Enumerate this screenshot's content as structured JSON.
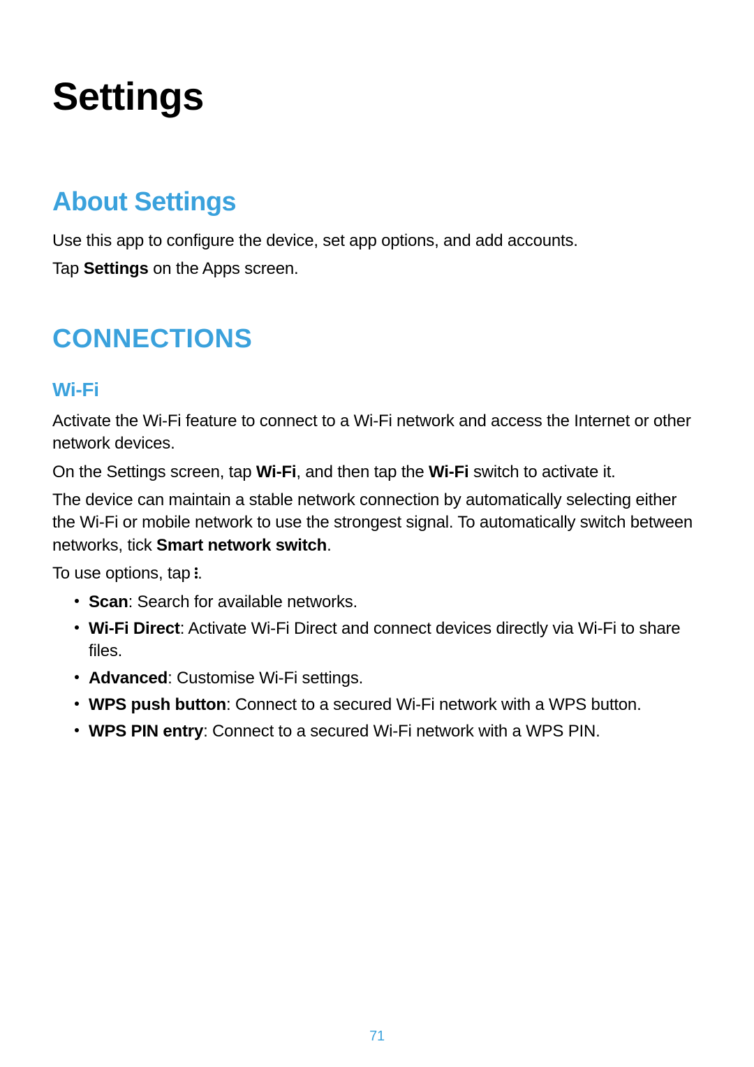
{
  "page_number": "71",
  "chapter_title": "Settings",
  "section_about": {
    "heading": "About Settings",
    "para1": "Use this app to configure the device, set app options, and add accounts.",
    "para2_prefix": "Tap ",
    "para2_bold": "Settings",
    "para2_suffix": " on the Apps screen."
  },
  "section_conn": {
    "heading": "CONNECTIONS",
    "wifi": {
      "heading": "Wi-Fi",
      "para1": "Activate the Wi-Fi feature to connect to a Wi-Fi network and access the Internet or other network devices.",
      "para2": {
        "a": "On the Settings screen, tap ",
        "b1": "Wi-Fi",
        "c": ", and then tap the ",
        "b2": "Wi-Fi",
        "d": " switch to activate it."
      },
      "para3": {
        "a": "The device can maintain a stable network connection by automatically selecting either the Wi-Fi or mobile network to use the strongest signal. To automatically switch between networks, tick ",
        "b": "Smart network switch",
        "c": "."
      },
      "para4_prefix": "To use options, tap ",
      "para4_suffix": ".",
      "options": [
        {
          "bold": "Scan",
          "text": ": Search for available networks."
        },
        {
          "bold": "Wi-Fi Direct",
          "text": ": Activate Wi-Fi Direct and connect devices directly via Wi-Fi to share files."
        },
        {
          "bold": "Advanced",
          "text": ": Customise Wi-Fi settings."
        },
        {
          "bold": "WPS push button",
          "text": ": Connect to a secured Wi-Fi network with a WPS button."
        },
        {
          "bold": "WPS PIN entry",
          "text": ": Connect to a secured Wi-Fi network with a WPS PIN."
        }
      ]
    }
  }
}
